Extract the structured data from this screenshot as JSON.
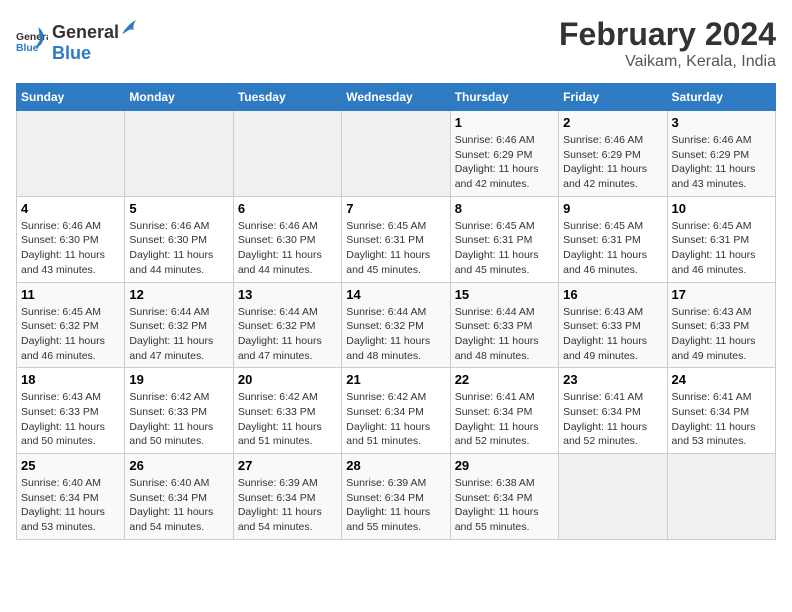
{
  "header": {
    "logo_general": "General",
    "logo_blue": "Blue",
    "title": "February 2024",
    "subtitle": "Vaikam, Kerala, India"
  },
  "columns": [
    "Sunday",
    "Monday",
    "Tuesday",
    "Wednesday",
    "Thursday",
    "Friday",
    "Saturday"
  ],
  "weeks": [
    {
      "days": [
        {
          "empty": true
        },
        {
          "empty": true
        },
        {
          "empty": true
        },
        {
          "empty": true
        },
        {
          "num": "1",
          "sunrise": "Sunrise: 6:46 AM",
          "sunset": "Sunset: 6:29 PM",
          "daylight": "Daylight: 11 hours and 42 minutes."
        },
        {
          "num": "2",
          "sunrise": "Sunrise: 6:46 AM",
          "sunset": "Sunset: 6:29 PM",
          "daylight": "Daylight: 11 hours and 42 minutes."
        },
        {
          "num": "3",
          "sunrise": "Sunrise: 6:46 AM",
          "sunset": "Sunset: 6:29 PM",
          "daylight": "Daylight: 11 hours and 43 minutes."
        }
      ]
    },
    {
      "days": [
        {
          "num": "4",
          "sunrise": "Sunrise: 6:46 AM",
          "sunset": "Sunset: 6:30 PM",
          "daylight": "Daylight: 11 hours and 43 minutes."
        },
        {
          "num": "5",
          "sunrise": "Sunrise: 6:46 AM",
          "sunset": "Sunset: 6:30 PM",
          "daylight": "Daylight: 11 hours and 44 minutes."
        },
        {
          "num": "6",
          "sunrise": "Sunrise: 6:46 AM",
          "sunset": "Sunset: 6:30 PM",
          "daylight": "Daylight: 11 hours and 44 minutes."
        },
        {
          "num": "7",
          "sunrise": "Sunrise: 6:45 AM",
          "sunset": "Sunset: 6:31 PM",
          "daylight": "Daylight: 11 hours and 45 minutes."
        },
        {
          "num": "8",
          "sunrise": "Sunrise: 6:45 AM",
          "sunset": "Sunset: 6:31 PM",
          "daylight": "Daylight: 11 hours and 45 minutes."
        },
        {
          "num": "9",
          "sunrise": "Sunrise: 6:45 AM",
          "sunset": "Sunset: 6:31 PM",
          "daylight": "Daylight: 11 hours and 46 minutes."
        },
        {
          "num": "10",
          "sunrise": "Sunrise: 6:45 AM",
          "sunset": "Sunset: 6:31 PM",
          "daylight": "Daylight: 11 hours and 46 minutes."
        }
      ]
    },
    {
      "days": [
        {
          "num": "11",
          "sunrise": "Sunrise: 6:45 AM",
          "sunset": "Sunset: 6:32 PM",
          "daylight": "Daylight: 11 hours and 46 minutes."
        },
        {
          "num": "12",
          "sunrise": "Sunrise: 6:44 AM",
          "sunset": "Sunset: 6:32 PM",
          "daylight": "Daylight: 11 hours and 47 minutes."
        },
        {
          "num": "13",
          "sunrise": "Sunrise: 6:44 AM",
          "sunset": "Sunset: 6:32 PM",
          "daylight": "Daylight: 11 hours and 47 minutes."
        },
        {
          "num": "14",
          "sunrise": "Sunrise: 6:44 AM",
          "sunset": "Sunset: 6:32 PM",
          "daylight": "Daylight: 11 hours and 48 minutes."
        },
        {
          "num": "15",
          "sunrise": "Sunrise: 6:44 AM",
          "sunset": "Sunset: 6:33 PM",
          "daylight": "Daylight: 11 hours and 48 minutes."
        },
        {
          "num": "16",
          "sunrise": "Sunrise: 6:43 AM",
          "sunset": "Sunset: 6:33 PM",
          "daylight": "Daylight: 11 hours and 49 minutes."
        },
        {
          "num": "17",
          "sunrise": "Sunrise: 6:43 AM",
          "sunset": "Sunset: 6:33 PM",
          "daylight": "Daylight: 11 hours and 49 minutes."
        }
      ]
    },
    {
      "days": [
        {
          "num": "18",
          "sunrise": "Sunrise: 6:43 AM",
          "sunset": "Sunset: 6:33 PM",
          "daylight": "Daylight: 11 hours and 50 minutes."
        },
        {
          "num": "19",
          "sunrise": "Sunrise: 6:42 AM",
          "sunset": "Sunset: 6:33 PM",
          "daylight": "Daylight: 11 hours and 50 minutes."
        },
        {
          "num": "20",
          "sunrise": "Sunrise: 6:42 AM",
          "sunset": "Sunset: 6:33 PM",
          "daylight": "Daylight: 11 hours and 51 minutes."
        },
        {
          "num": "21",
          "sunrise": "Sunrise: 6:42 AM",
          "sunset": "Sunset: 6:34 PM",
          "daylight": "Daylight: 11 hours and 51 minutes."
        },
        {
          "num": "22",
          "sunrise": "Sunrise: 6:41 AM",
          "sunset": "Sunset: 6:34 PM",
          "daylight": "Daylight: 11 hours and 52 minutes."
        },
        {
          "num": "23",
          "sunrise": "Sunrise: 6:41 AM",
          "sunset": "Sunset: 6:34 PM",
          "daylight": "Daylight: 11 hours and 52 minutes."
        },
        {
          "num": "24",
          "sunrise": "Sunrise: 6:41 AM",
          "sunset": "Sunset: 6:34 PM",
          "daylight": "Daylight: 11 hours and 53 minutes."
        }
      ]
    },
    {
      "days": [
        {
          "num": "25",
          "sunrise": "Sunrise: 6:40 AM",
          "sunset": "Sunset: 6:34 PM",
          "daylight": "Daylight: 11 hours and 53 minutes."
        },
        {
          "num": "26",
          "sunrise": "Sunrise: 6:40 AM",
          "sunset": "Sunset: 6:34 PM",
          "daylight": "Daylight: 11 hours and 54 minutes."
        },
        {
          "num": "27",
          "sunrise": "Sunrise: 6:39 AM",
          "sunset": "Sunset: 6:34 PM",
          "daylight": "Daylight: 11 hours and 54 minutes."
        },
        {
          "num": "28",
          "sunrise": "Sunrise: 6:39 AM",
          "sunset": "Sunset: 6:34 PM",
          "daylight": "Daylight: 11 hours and 55 minutes."
        },
        {
          "num": "29",
          "sunrise": "Sunrise: 6:38 AM",
          "sunset": "Sunset: 6:34 PM",
          "daylight": "Daylight: 11 hours and 55 minutes."
        },
        {
          "empty": true
        },
        {
          "empty": true
        }
      ]
    }
  ]
}
